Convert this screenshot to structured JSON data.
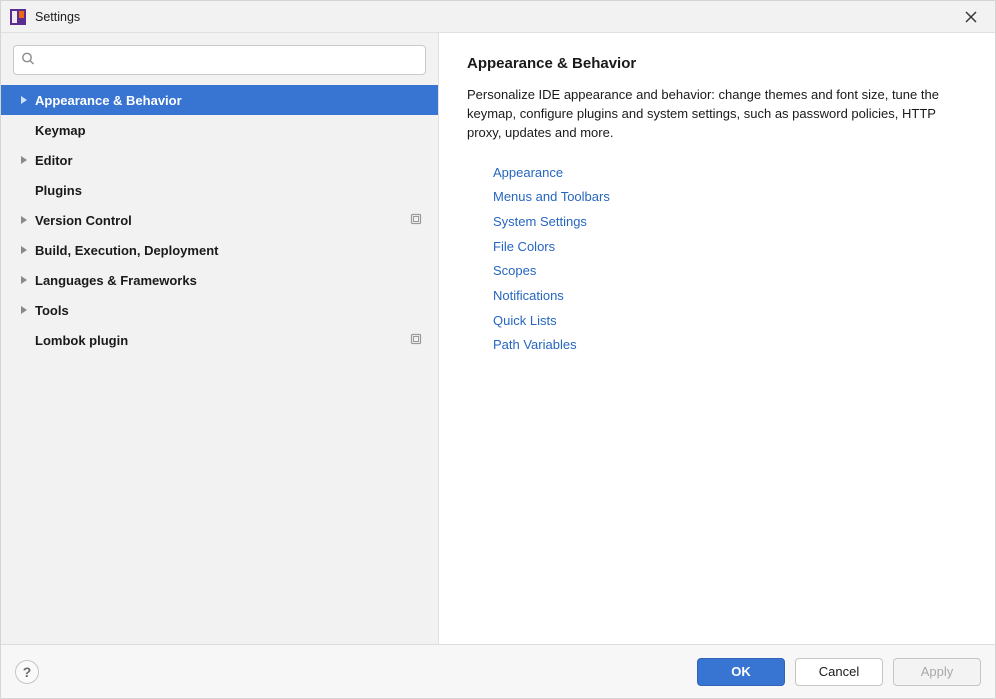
{
  "window": {
    "title": "Settings"
  },
  "search": {
    "placeholder": "",
    "value": ""
  },
  "sidebar": {
    "items": [
      {
        "label": "Appearance & Behavior",
        "expandable": true,
        "selected": true,
        "extra": null
      },
      {
        "label": "Keymap",
        "expandable": false,
        "selected": false,
        "extra": null
      },
      {
        "label": "Editor",
        "expandable": true,
        "selected": false,
        "extra": null
      },
      {
        "label": "Plugins",
        "expandable": false,
        "selected": false,
        "extra": null
      },
      {
        "label": "Version Control",
        "expandable": true,
        "selected": false,
        "extra": "profile-icon"
      },
      {
        "label": "Build, Execution, Deployment",
        "expandable": true,
        "selected": false,
        "extra": null
      },
      {
        "label": "Languages & Frameworks",
        "expandable": true,
        "selected": false,
        "extra": null
      },
      {
        "label": "Tools",
        "expandable": true,
        "selected": false,
        "extra": null
      },
      {
        "label": "Lombok plugin",
        "expandable": false,
        "selected": false,
        "extra": "profile-icon"
      }
    ]
  },
  "main": {
    "title": "Appearance & Behavior",
    "description": "Personalize IDE appearance and behavior: change themes and font size, tune the keymap, configure plugins and system settings, such as password policies, HTTP proxy, updates and more.",
    "links": [
      "Appearance",
      "Menus and Toolbars",
      "System Settings",
      "File Colors",
      "Scopes",
      "Notifications",
      "Quick Lists",
      "Path Variables"
    ]
  },
  "footer": {
    "ok": "OK",
    "cancel": "Cancel",
    "apply": "Apply"
  }
}
